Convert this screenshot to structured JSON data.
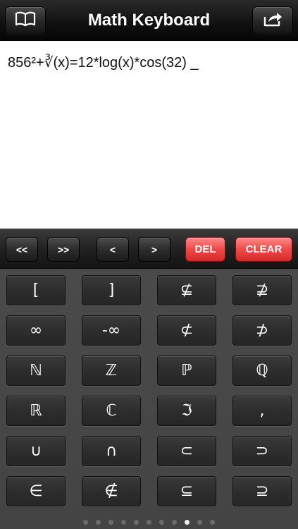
{
  "nav": {
    "title": "Math Keyboard",
    "left_icon": "book-icon",
    "right_icon": "share-icon"
  },
  "display": {
    "expression": "856²+∛(x)=12*log(x)*cos(32) _"
  },
  "toolbar": {
    "prev_word": "<<",
    "next_word": ">>",
    "prev_char": "<",
    "next_char": ">",
    "delete": "DEL",
    "clear": "CLEAR"
  },
  "keys": [
    [
      "[",
      "]",
      "⊈",
      "⊉"
    ],
    [
      "∞",
      "-∞",
      "⊄",
      "⊅"
    ],
    [
      "ℕ",
      "ℤ",
      "ℙ",
      "ℚ"
    ],
    [
      "ℝ",
      "ℂ",
      "ℑ",
      ","
    ],
    [
      "∪",
      "∩",
      "⊂",
      "⊃"
    ],
    [
      "∈",
      "∉",
      "⊆",
      "⊇"
    ]
  ],
  "pager": {
    "pages": 11,
    "current": 9
  },
  "colors": {
    "accent_red": "#f04848",
    "key_bg": "#2d2d2d",
    "keypad_bg": "#474747"
  }
}
